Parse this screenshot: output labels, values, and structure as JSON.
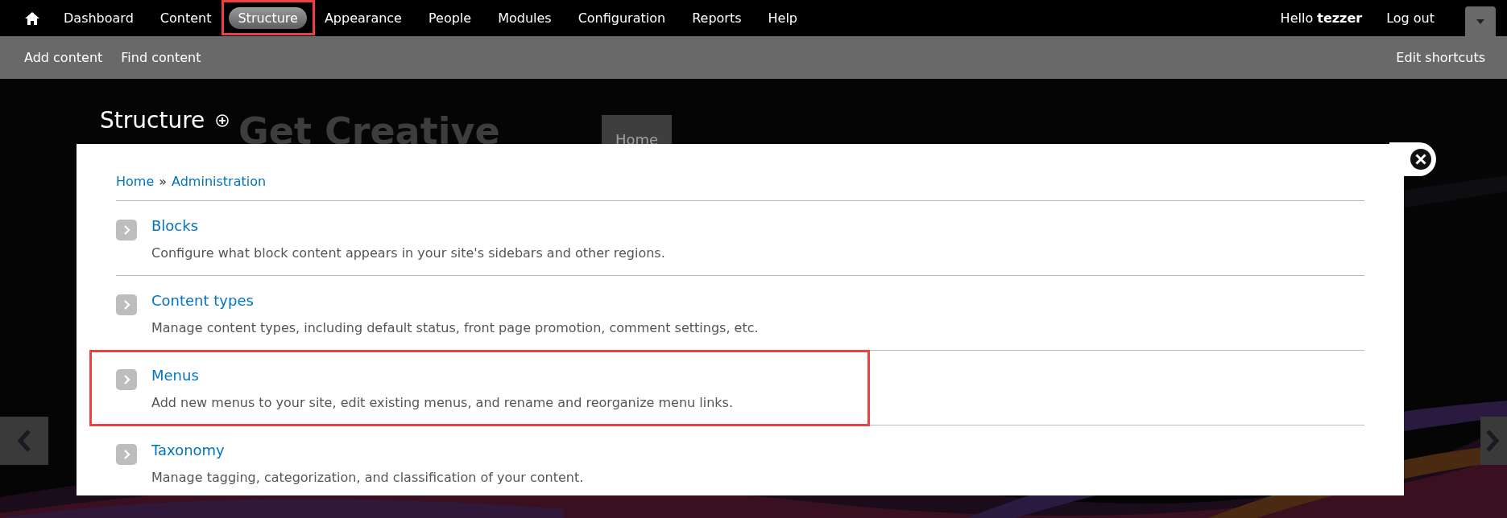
{
  "toolbar": {
    "menu": [
      {
        "label": "Dashboard",
        "selected": false,
        "highlighted": false
      },
      {
        "label": "Content",
        "selected": false,
        "highlighted": false
      },
      {
        "label": "Structure",
        "selected": true,
        "highlighted": true
      },
      {
        "label": "Appearance",
        "selected": false,
        "highlighted": false
      },
      {
        "label": "People",
        "selected": false,
        "highlighted": false
      },
      {
        "label": "Modules",
        "selected": false,
        "highlighted": false
      },
      {
        "label": "Configuration",
        "selected": false,
        "highlighted": false
      },
      {
        "label": "Reports",
        "selected": false,
        "highlighted": false
      },
      {
        "label": "Help",
        "selected": false,
        "highlighted": false
      }
    ],
    "greeting": "Hello **tezzer**",
    "logout": "Log out"
  },
  "shortcuts": {
    "links": [
      "Add content",
      "Find content"
    ],
    "edit": "Edit shortcuts"
  },
  "page": {
    "title": "Structure",
    "slide_heading": "Get Creative",
    "slide_tab": "Home"
  },
  "overlay": {
    "breadcrumb": [
      "Home",
      "Administration"
    ],
    "separator": "»",
    "items": [
      {
        "title": "Blocks",
        "description": "Configure what block content appears in your site's sidebars and other regions.",
        "highlighted": false
      },
      {
        "title": "Content types",
        "description": "Manage content types, including default status, front page promotion, comment settings, etc.",
        "highlighted": false
      },
      {
        "title": "Menus",
        "description": "Add new menus to your site, edit existing menus, and rename and reorganize menu links.",
        "highlighted": true
      },
      {
        "title": "Taxonomy",
        "description": "Manage tagging, categorization, and classification of your content.",
        "highlighted": false
      }
    ]
  }
}
